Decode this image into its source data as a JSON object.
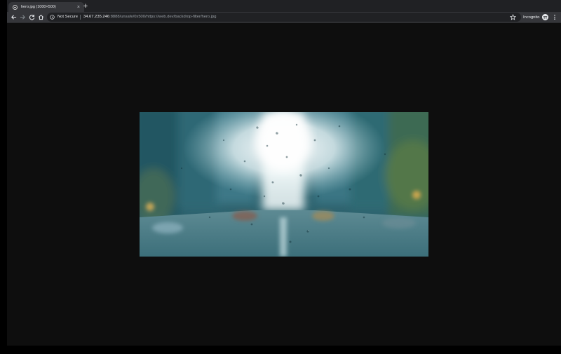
{
  "browser": {
    "tab": {
      "title": "hero.jpg (1000×500)",
      "close_glyph": "×"
    },
    "new_tab_glyph": "+",
    "toolbar": {
      "icons": [
        "back-arrow-icon",
        "forward-arrow-icon",
        "reload-icon",
        "home-icon"
      ],
      "security_label": "Not Secure",
      "url_host": "34.67.235.246",
      "url_path": ":8888/unsafe/0x500/https://web.dev/backdrop-filter/hero.jpg",
      "incognito_label": "Incognito"
    }
  },
  "content": {
    "image_description_icon": "rainy-city-street-photo"
  },
  "colors": {
    "tabstrip": "#202124",
    "toolbar": "#35363a",
    "page_background": "#0e0e0e"
  }
}
